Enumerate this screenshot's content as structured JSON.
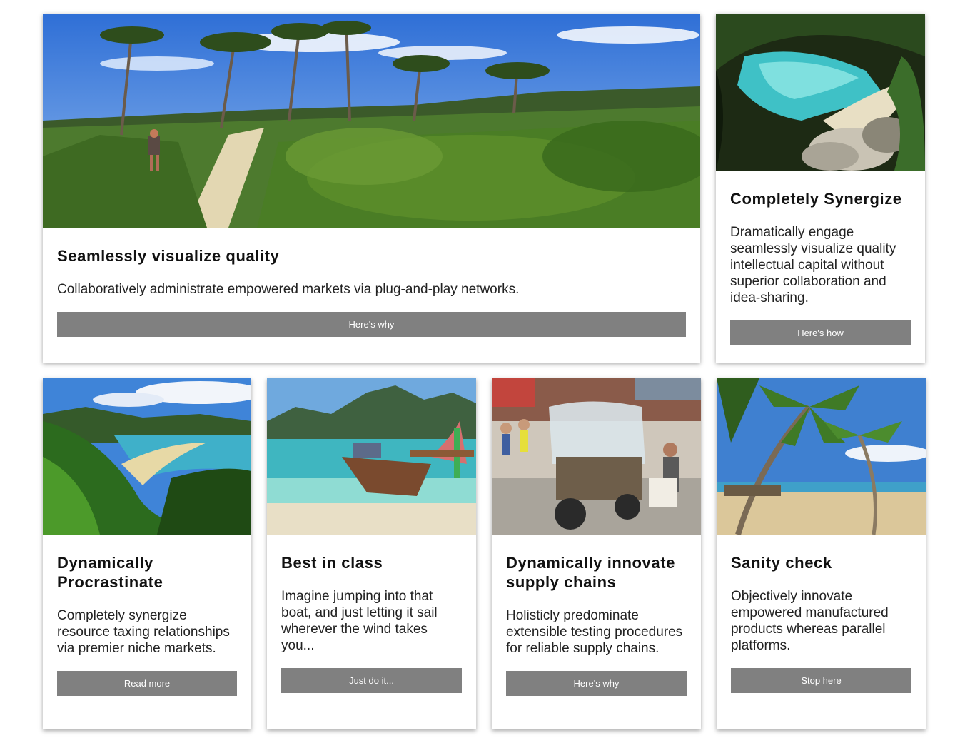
{
  "cards": [
    {
      "title": "Seamlessly visualize quality",
      "text": "Collaboratively administrate empowered markets via plug-and-play networks.",
      "button": "Here's why",
      "image": "hiking-trail-forest-photo"
    },
    {
      "title": "Completely Synergize",
      "text": "Dramatically engage seamlessly visualize quality intellectual capital without superior collaboration and idea-sharing.",
      "button": "Here's how",
      "image": "turquoise-cove-beach-photo"
    },
    {
      "title": "Dynamically Procrastinate",
      "text": "Completely synergize resource taxing relationships via premier niche markets.",
      "button": "Read more",
      "image": "fern-bay-beach-photo"
    },
    {
      "title": "Best in class",
      "text": "Imagine jumping into that boat, and just letting it sail wherever the wind takes you...",
      "button": "Just do it...",
      "image": "longtail-boat-lagoon-photo"
    },
    {
      "title": "Dynamically innovate supply chains",
      "text": "Holisticly predominate extensible testing procedures for reliable supply chains.",
      "button": "Here's why",
      "image": "tuk-tuk-street-market-photo"
    },
    {
      "title": "Sanity check",
      "text": "Objectively innovate empowered manufactured products whereas parallel platforms.",
      "button": "Stop here",
      "image": "palm-tree-beach-photo"
    }
  ],
  "colors": {
    "button_bg": "#808080",
    "button_text": "#ffffff",
    "title": "#111111"
  }
}
